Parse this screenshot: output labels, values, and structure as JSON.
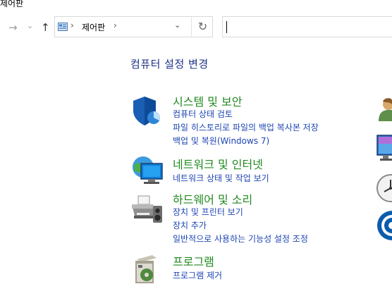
{
  "window": {
    "title": "제어판"
  },
  "nav": {
    "back_glyph": "→",
    "recent_glyph": "⌄",
    "up_glyph": "↑",
    "refresh_glyph": "↻",
    "sep_glyph": "›",
    "dropdown_glyph": "⌄"
  },
  "address": {
    "crumb": "제어판"
  },
  "search": {
    "value": ""
  },
  "heading": "컴퓨터 설정 변경",
  "categories": [
    {
      "icon": "shield-icon",
      "title": "시스템 및 보안",
      "links": [
        "컴퓨터 상태 검토",
        "파일 히스토리로 파일의 백업 복사본 저장",
        "백업 및 복원(Windows 7)"
      ]
    },
    {
      "icon": "network-globe-icon",
      "title": "네트워크 및 인터넷",
      "links": [
        "네트워크 상태 및 작업 보기"
      ]
    },
    {
      "icon": "printer-icon",
      "title": "하드웨어 및 소리",
      "links": [
        "장치 및 프린터 보기",
        "장치 추가",
        "일반적으로 사용하는 기능성 설정 조정"
      ]
    },
    {
      "icon": "programs-icon",
      "title": "프로그램",
      "links": [
        "프로그램 제거"
      ]
    }
  ],
  "colors": {
    "heading": "#1e3287",
    "category_title": "#218a21",
    "link": "#1e45b4"
  }
}
